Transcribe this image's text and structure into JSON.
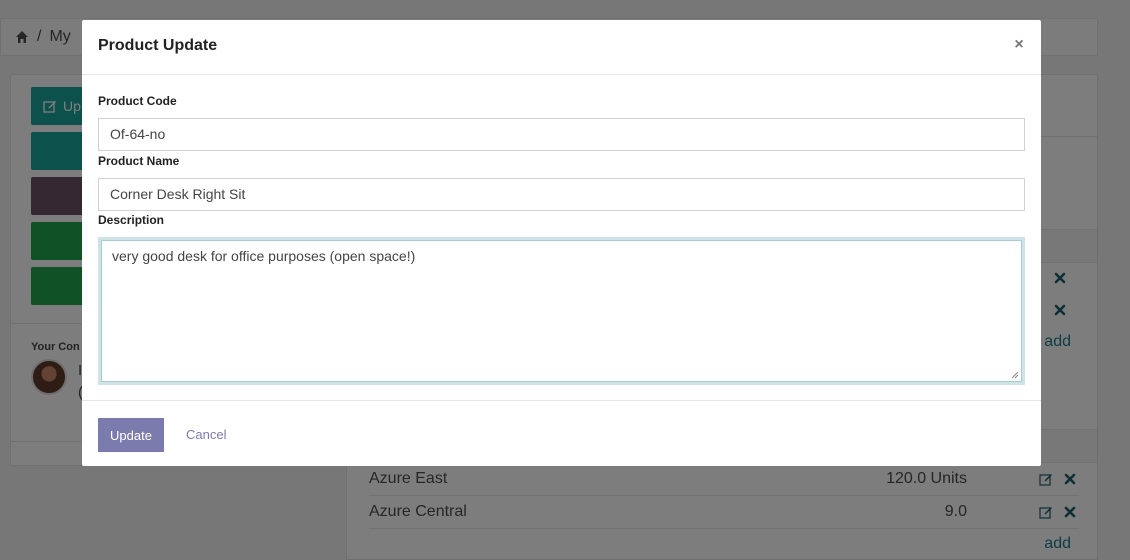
{
  "breadcrumb": {
    "home_icon": "home-icon",
    "current": "My"
  },
  "left_panel": {
    "buttons": [
      {
        "label": "Up",
        "icon": "edit-icon",
        "color": "#1aa39a"
      },
      {
        "label": "",
        "color": "#1aa39a"
      },
      {
        "label": "",
        "color": "#6a5060"
      },
      {
        "label": "",
        "icon": "upload-icon",
        "color": "#21a54a"
      },
      {
        "label": "",
        "icon": "upload-icon",
        "color": "#21a54a"
      }
    ],
    "contact_title": "Your Con",
    "contact_lines": [
      "I",
      "("
    ]
  },
  "right_panel": {
    "add_label": "add",
    "rows": [
      {
        "name": "Azure East",
        "qty": "120.0 Units"
      },
      {
        "name": "Azure Central",
        "qty": "9.0"
      }
    ]
  },
  "modal": {
    "title": "Product Update",
    "close_label": "×",
    "fields": {
      "code_label": "Product Code",
      "code_value": "Of-64-no",
      "name_label": "Product Name",
      "name_value": "Corner Desk Right Sit",
      "description_label": "Description",
      "description_value": "very good desk for office purposes (open space!)"
    },
    "update_label": "Update",
    "cancel_label": "Cancel"
  },
  "colors": {
    "primary": "#7c7bad",
    "teal": "#1aa39a",
    "green": "#21a54a",
    "link": "#1b7c8a"
  }
}
